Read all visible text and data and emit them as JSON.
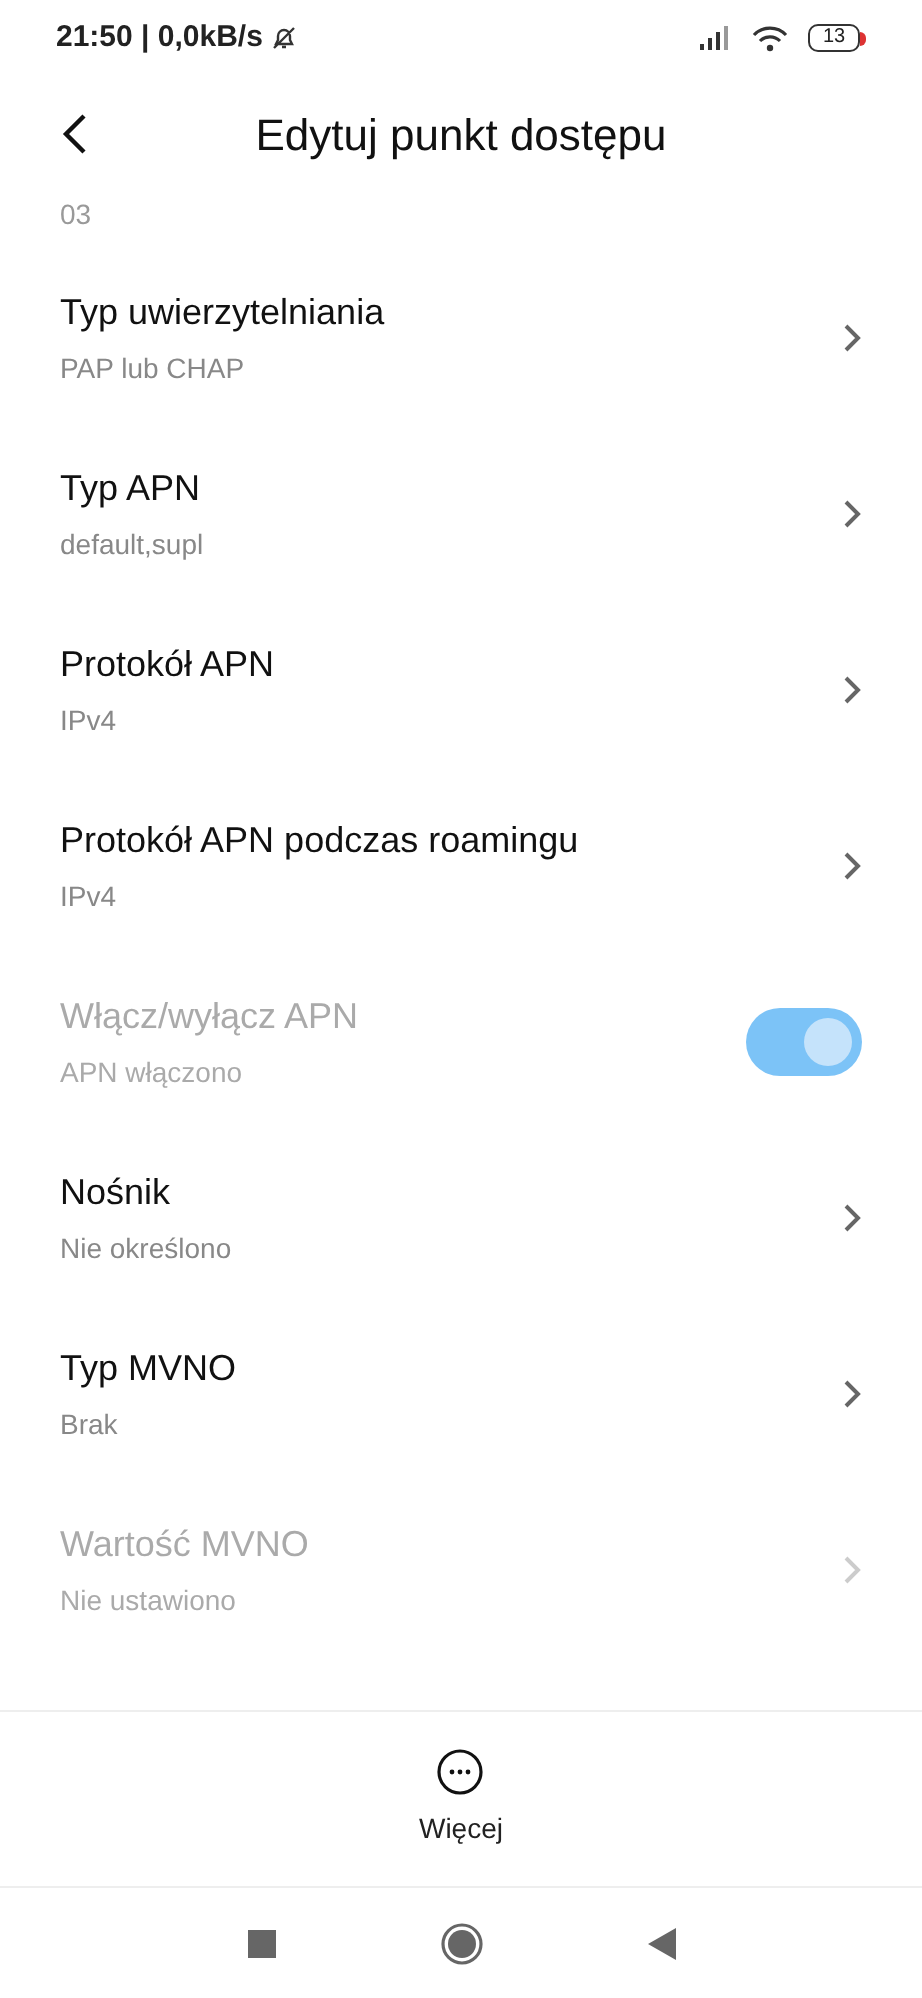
{
  "status_bar": {
    "time": "21:50 | 0,0kB/s",
    "battery": "13"
  },
  "header": {
    "title": "Edytuj punkt dostępu"
  },
  "previous_value": "03",
  "settings": [
    {
      "kind": "nav",
      "title": "Typ uwierzytelniania",
      "value": "PAP lub CHAP",
      "disabled": false
    },
    {
      "kind": "nav",
      "title": "Typ APN",
      "value": "default,supl",
      "disabled": false
    },
    {
      "kind": "nav",
      "title": "Protokół APN",
      "value": "IPv4",
      "disabled": false
    },
    {
      "kind": "nav",
      "title": "Protokół APN podczas roamingu",
      "value": "IPv4",
      "disabled": false
    },
    {
      "kind": "toggle",
      "title": "Włącz/wyłącz APN",
      "value": "APN włączono",
      "disabled": true,
      "on": true
    },
    {
      "kind": "nav",
      "title": "Nośnik",
      "value": "Nie określono",
      "disabled": false
    },
    {
      "kind": "nav",
      "title": "Typ MVNO",
      "value": "Brak",
      "disabled": false
    },
    {
      "kind": "nav",
      "title": "Wartość MVNO",
      "value": "Nie ustawiono",
      "disabled": true
    }
  ],
  "bottom_action": {
    "label": "Więcej"
  }
}
